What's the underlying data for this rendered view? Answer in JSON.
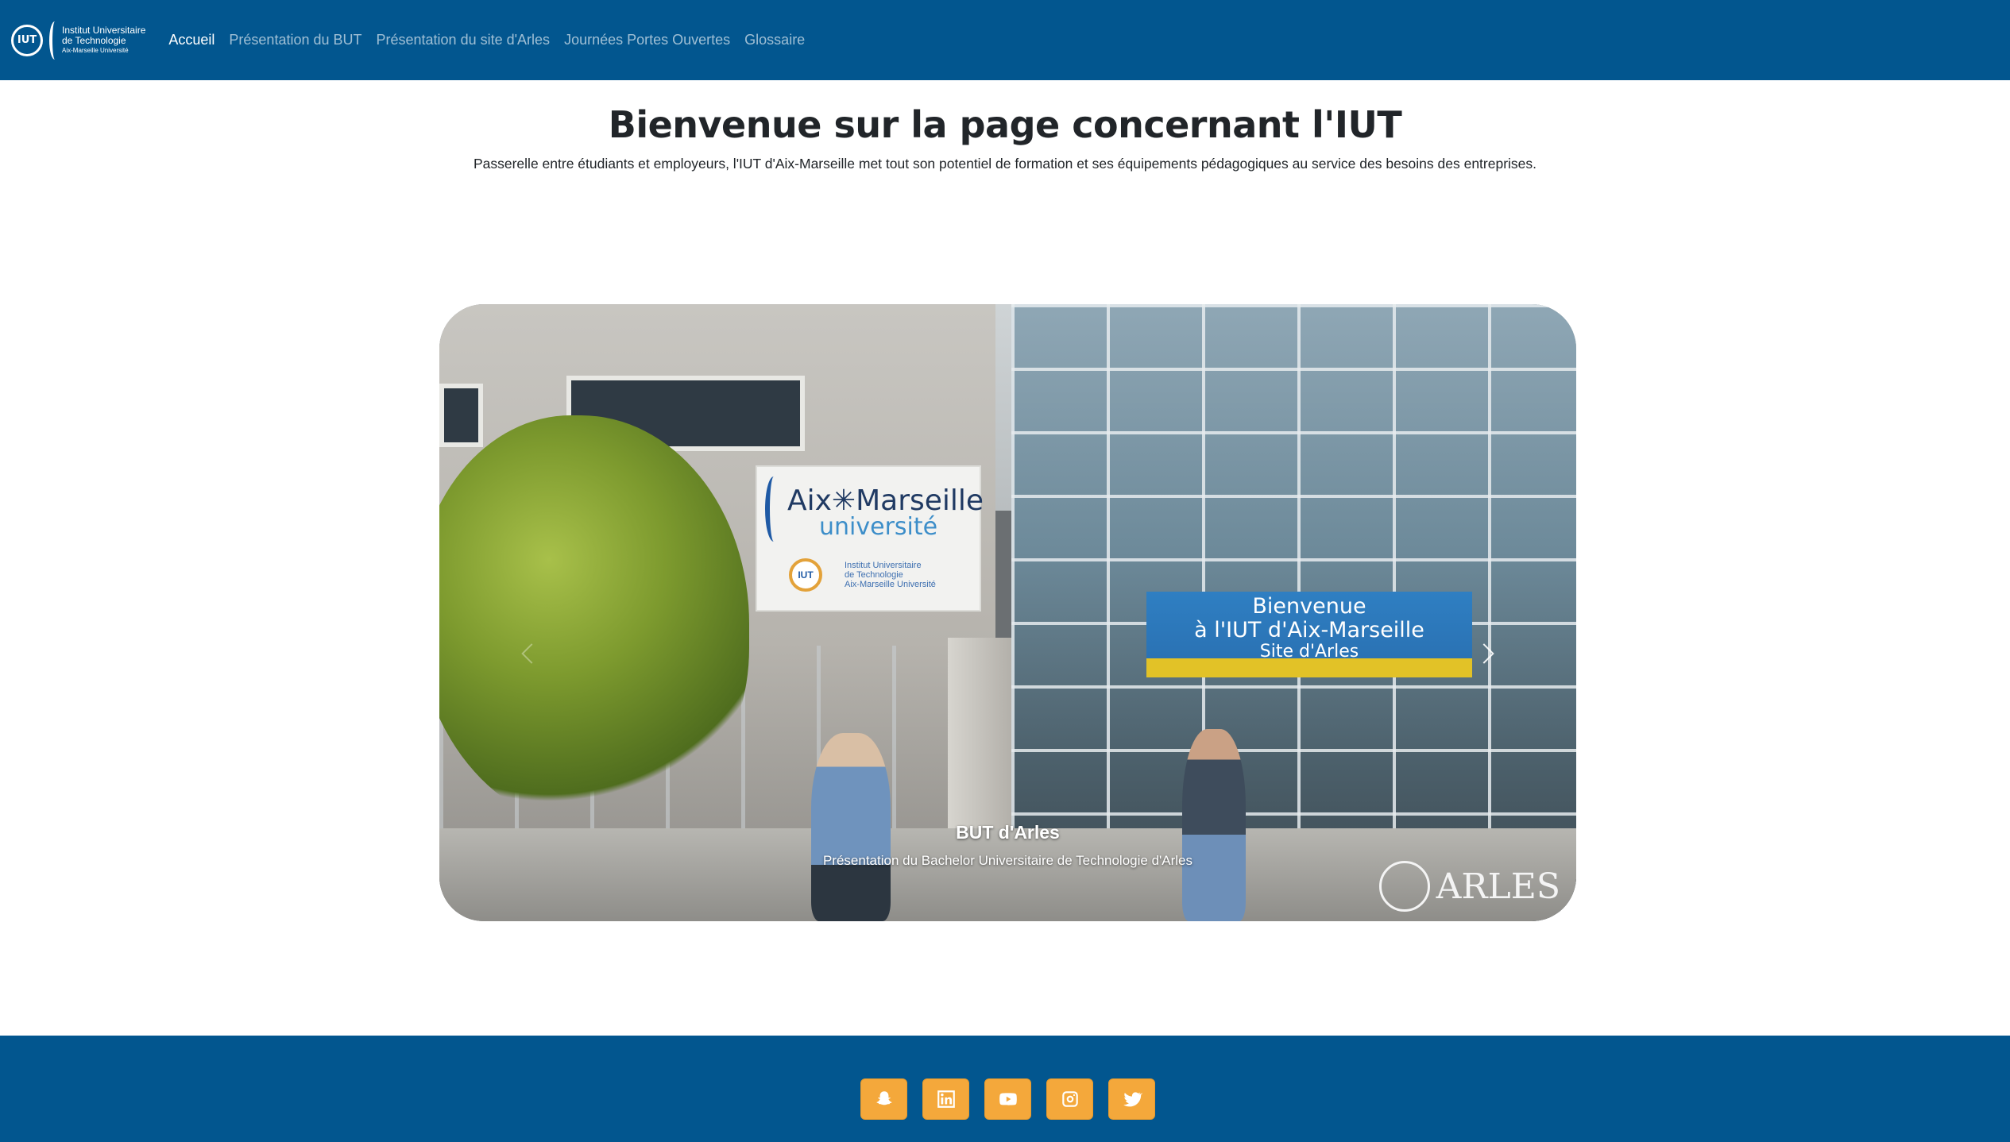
{
  "navbar": {
    "logo": {
      "badge": "IUT",
      "line1": "Institut Universitaire",
      "line2": "de Technologie",
      "line3": "Aix-Marseille Université"
    },
    "links": [
      {
        "label": "Accueil",
        "active": true
      },
      {
        "label": "Présentation du BUT",
        "active": false
      },
      {
        "label": "Présentation du site d'Arles",
        "active": false
      },
      {
        "label": "Journées Portes Ouvertes",
        "active": false
      },
      {
        "label": "Glossaire",
        "active": false
      }
    ],
    "background_color": "#02568f"
  },
  "header": {
    "title": "Bienvenue sur la page concernant l'IUT",
    "lead": "Passerelle entre étudiants et employeurs, l'IUT d'Aix-Marseille met tout son potentiel de formation et ses équipements pédagogiques au service des besoins des entreprises."
  },
  "carousel": {
    "slide": {
      "caption_title": "BUT d'Arles",
      "caption_text": "Présentation du Bachelor Universitaire de Technologie d'Arles",
      "photo_sign_main": "Aix✳Marseille",
      "photo_sign_sub": "université",
      "photo_sign_small_1": "Institut Universitaire",
      "photo_sign_small_2": "de Technologie",
      "photo_sign_small_3": "Aix-Marseille Université",
      "photo_banner_line1": "Bienvenue",
      "photo_banner_line2": "à l'IUT d'Aix-Marseille",
      "photo_banner_line3": "Site d'Arles",
      "watermark": "ARLES"
    },
    "controls": {
      "prev_icon": "chevron-left-icon",
      "next_icon": "chevron-right-icon"
    }
  },
  "footer": {
    "background_color": "#02568f",
    "socials": [
      {
        "name": "snapchat",
        "icon": "snapchat-icon"
      },
      {
        "name": "linkedin",
        "icon": "linkedin-icon"
      },
      {
        "name": "youtube",
        "icon": "youtube-icon"
      },
      {
        "name": "instagram",
        "icon": "instagram-icon"
      },
      {
        "name": "twitter",
        "icon": "twitter-icon"
      }
    ],
    "button_color": "#f4a83b"
  }
}
